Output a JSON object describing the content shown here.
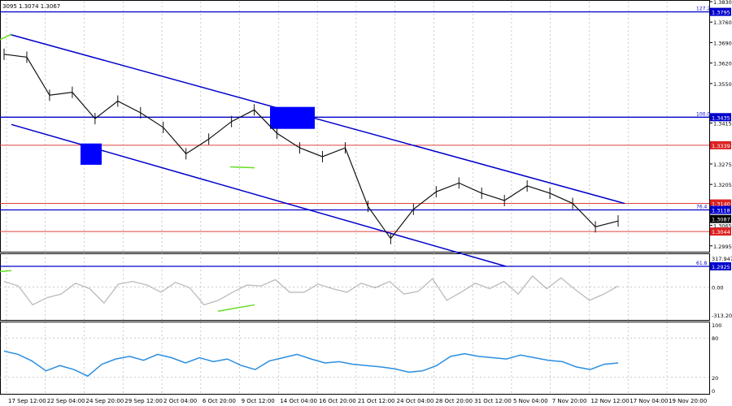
{
  "header": {
    "ohlc_text": "3095 1.3074 1.3067"
  },
  "colors": {
    "channel": "#0000cc",
    "level": "#0000cc",
    "red_level": "#e04040",
    "green": "#66dd22",
    "price": "#111111",
    "cci": "#bbbbbb",
    "rsi": "#2a8ee0",
    "grid": "#aaaaaa",
    "box": "#0000ff"
  },
  "fib_labels": {
    "f127": "127.2",
    "f100": "100.0",
    "f76": "76.4",
    "f61": "61.8"
  },
  "cci_ticks": [
    "317.9471",
    "0.00",
    "-313.2094"
  ],
  "rsi_ticks": [
    "100",
    "80",
    "20",
    "0"
  ],
  "chart_data": [
    {
      "type": "line",
      "title": "",
      "x": [
        "17 Sep 12:00",
        "22 Sep 04:00",
        "24 Sep 20:00",
        "29 Sep 12:00",
        "2 Oct 04:00",
        "6 Oct 20:00",
        "9 Oct 12:00",
        "14 Oct 04:00",
        "16 Oct 20:00",
        "21 Oct 12:00",
        "24 Oct 04:00",
        "28 Oct 20:00",
        "31 Oct 12:00",
        "5 Nov 04:00",
        "7 Nov 20:00",
        "12 Nov 12:00",
        "17 Nov 04:00",
        "19 Nov 20:00"
      ],
      "ylim": [
        1.2975,
        1.383
      ],
      "y_ticks": [
        "1.3830",
        "1.3760",
        "1.3690",
        "1.3620",
        "1.3550",
        "1.3415",
        "1.3345",
        "1.3275",
        "1.3205",
        "1.3065",
        "1.2995"
      ],
      "series": [
        {
          "values": [
            1.365,
            1.364,
            1.351,
            1.352,
            1.343,
            1.349,
            1.345,
            1.34,
            1.331,
            1.336,
            1.342,
            1.346,
            1.338,
            1.333,
            1.33,
            1.333,
            1.313,
            1.302,
            1.312,
            1.318,
            1.321,
            1.3175,
            1.315,
            1.32,
            1.3175,
            1.314,
            1.306,
            1.308
          ]
        }
      ],
      "price_labels": [
        {
          "value": 1.3795,
          "text": "1.3795"
        },
        {
          "value": 1.3435,
          "text": "1.3435"
        },
        {
          "value": 1.3339,
          "text": "1.3339"
        },
        {
          "value": 1.314,
          "text": "1.3140"
        },
        {
          "value": 1.3118,
          "text": "1.3118"
        },
        {
          "value": 1.3087,
          "text": "1.3087"
        },
        {
          "value": 1.3044,
          "text": "1.3044"
        },
        {
          "value": 1.2925,
          "text": "1.2925"
        }
      ],
      "horizontal_levels": [
        {
          "value": 1.3795,
          "kind": "fib"
        },
        {
          "value": 1.3435,
          "kind": "fib"
        },
        {
          "value": 1.3339,
          "kind": "red"
        },
        {
          "value": 1.314,
          "kind": "red"
        },
        {
          "value": 1.3118,
          "kind": "fib"
        },
        {
          "value": 1.3044,
          "kind": "red"
        },
        {
          "value": 1.2925,
          "kind": "fib"
        }
      ],
      "channel_lines": [
        {
          "from": [
            "t0",
            1.3718
          ],
          "to": [
            "t-end",
            1.314
          ]
        },
        {
          "from": [
            "t0",
            1.341
          ],
          "to": [
            "t-mid",
            1.2925
          ]
        }
      ]
    },
    {
      "type": "line",
      "title": "",
      "ylim": [
        -313.2094,
        317.9471
      ],
      "series": [
        {
          "values": [
            60,
            10,
            -200,
            -120,
            -80,
            40,
            -20,
            -180,
            30,
            60,
            20,
            -60,
            50,
            -10,
            -200,
            -150,
            -60,
            20,
            10,
            80,
            -60,
            -60,
            30,
            -20,
            -60,
            40,
            -10,
            60,
            -80,
            -50,
            90,
            -150,
            -60,
            40,
            -20,
            60,
            -80,
            120,
            -20,
            100,
            -30,
            -150,
            -80,
            10
          ]
        }
      ]
    },
    {
      "type": "line",
      "title": "",
      "ylim": [
        0,
        100
      ],
      "series": [
        {
          "values": [
            60,
            55,
            45,
            30,
            38,
            32,
            22,
            40,
            48,
            52,
            46,
            55,
            50,
            42,
            50,
            44,
            48,
            38,
            32,
            45,
            50,
            55,
            48,
            42,
            44,
            40,
            38,
            36,
            33,
            28,
            30,
            38,
            52,
            56,
            52,
            50,
            48,
            54,
            50,
            46,
            44,
            36,
            32,
            40,
            42
          ]
        }
      ]
    }
  ]
}
